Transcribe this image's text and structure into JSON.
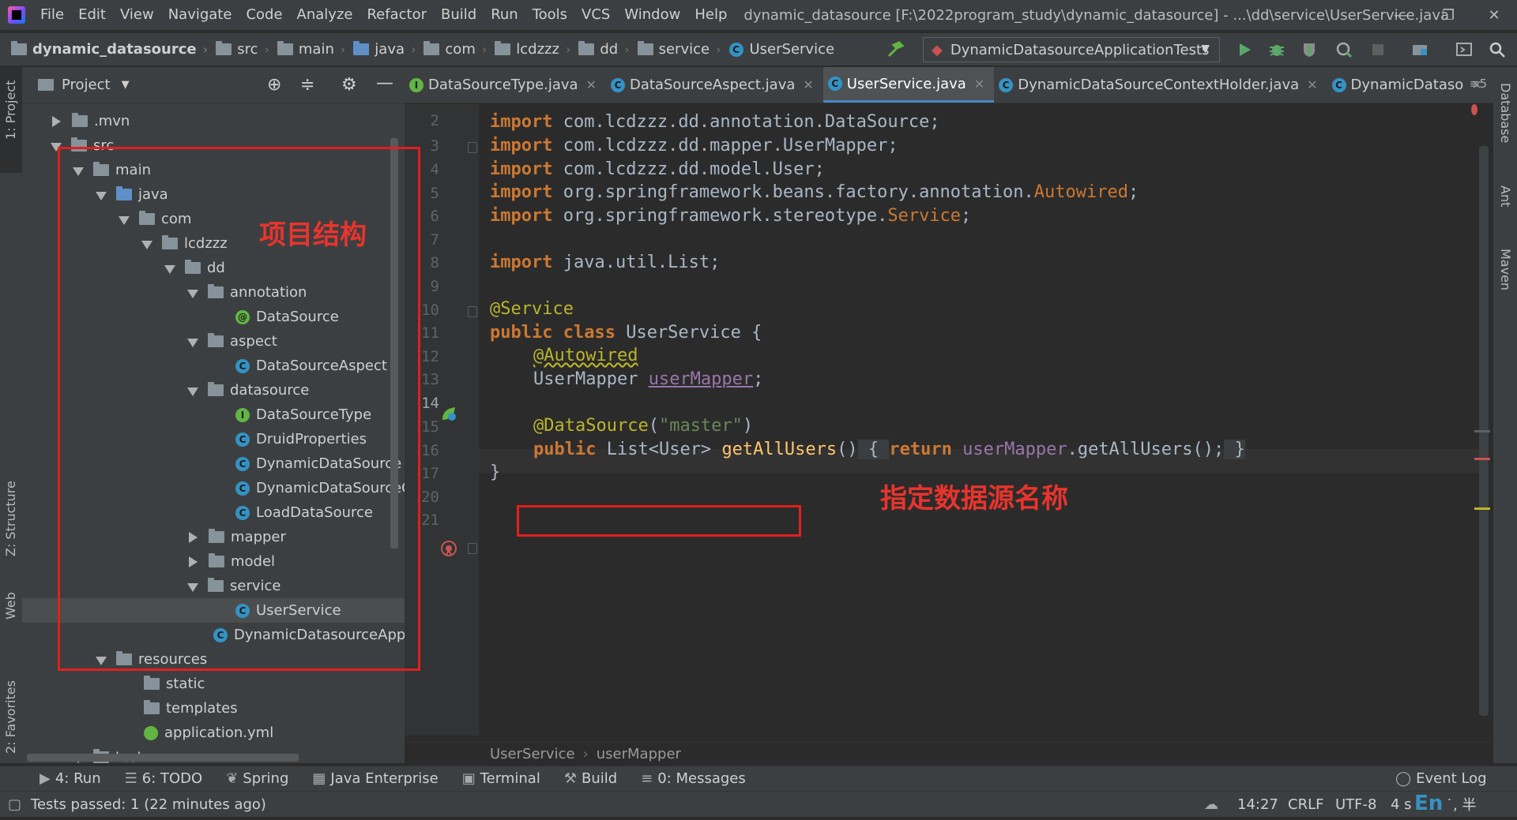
{
  "menu": {
    "items": [
      "File",
      "Edit",
      "View",
      "Navigate",
      "Code",
      "Analyze",
      "Refactor",
      "Build",
      "Run",
      "Tools",
      "VCS",
      "Window",
      "Help"
    ],
    "window_title": "dynamic_datasource [F:\\2022program_study\\dynamic_datasource] - ...\\dd\\service\\UserService.java",
    "minimize": "—",
    "restore": "❐",
    "close": "✕"
  },
  "navbar": {
    "crumbs": [
      "dynamic_datasource",
      "src",
      "main",
      "java",
      "com",
      "lcdzzz",
      "dd",
      "service",
      "UserService"
    ],
    "run_config": "DynamicDatasourceApplicationTests"
  },
  "left_strip": {
    "project": "1: Project",
    "structure": "Z: Structure",
    "web": "Web",
    "favorites": "2: Favorites"
  },
  "right_strip": {
    "database": "Database",
    "ant": "Ant",
    "maven": "Maven"
  },
  "project_panel": {
    "title": "Project",
    "tree": [
      {
        "label": ".mvn",
        "icon": "folder"
      },
      {
        "label": "src",
        "icon": "folder"
      },
      {
        "label": "main",
        "icon": "folder"
      },
      {
        "label": "java",
        "icon": "folder-blue"
      },
      {
        "label": "com",
        "icon": "folder"
      },
      {
        "label": "lcdzzz",
        "icon": "folder"
      },
      {
        "label": "dd",
        "icon": "folder"
      },
      {
        "label": "annotation",
        "icon": "folder"
      },
      {
        "label": "DataSource",
        "icon": "annotation"
      },
      {
        "label": "aspect",
        "icon": "folder"
      },
      {
        "label": "DataSourceAspect",
        "icon": "class"
      },
      {
        "label": "datasource",
        "icon": "folder"
      },
      {
        "label": "DataSourceType",
        "icon": "interface"
      },
      {
        "label": "DruidProperties",
        "icon": "class"
      },
      {
        "label": "DynamicDataSource",
        "icon": "class"
      },
      {
        "label": "DynamicDataSourceCo",
        "icon": "class"
      },
      {
        "label": "LoadDataSource",
        "icon": "class"
      },
      {
        "label": "mapper",
        "icon": "folder"
      },
      {
        "label": "model",
        "icon": "folder"
      },
      {
        "label": "service",
        "icon": "folder"
      },
      {
        "label": "UserService",
        "icon": "class"
      },
      {
        "label": "DynamicDatasourceApplic",
        "icon": "spring-class"
      },
      {
        "label": "resources",
        "icon": "folder"
      },
      {
        "label": "static",
        "icon": "folder"
      },
      {
        "label": "templates",
        "icon": "folder"
      },
      {
        "label": "application.yml",
        "icon": "yml"
      },
      {
        "label": "test",
        "icon": "folder"
      }
    ]
  },
  "editor": {
    "tabs": [
      {
        "label": "DataSourceType.java",
        "icon": "I"
      },
      {
        "label": "DataSourceAspect.java",
        "icon": "C"
      },
      {
        "label": "UserService.java",
        "icon": "C"
      },
      {
        "label": "DynamicDataSourceContextHolder.java",
        "icon": "C"
      },
      {
        "label": "DynamicDataso",
        "icon": "C"
      }
    ],
    "tab_close": "✕",
    "tab_overflow": "≡5",
    "line_numbers": [
      "2",
      "3",
      "4",
      "5",
      "6",
      "7",
      "8",
      "9",
      "10",
      "11",
      "12",
      "13",
      "14",
      "15",
      "16",
      "17",
      "20",
      "21"
    ],
    "code": {
      "l3_kw": "import",
      "l3_pkg": " com.lcdzzz.dd.annotation.",
      "l3_cls": "DataSource",
      "l3_end": ";",
      "l4_kw": "import",
      "l4_pkg": " com.lcdzzz.dd.mapper.UserMapper;",
      "l5_kw": "import",
      "l5_pkg": " com.lcdzzz.dd.model.User;",
      "l6_kw": "import",
      "l6_pkg": " org.springframework.beans.factory.annotation.",
      "l6_cls": "Autowired",
      "l6_end": ";",
      "l7_kw": "import",
      "l7_pkg": " org.springframework.stereotype.",
      "l7_cls": "Service",
      "l7_end": ";",
      "l9_kw": "import",
      "l9_pkg": " java.util.List;",
      "l11_ann": "@Service",
      "l12_kw": "public class",
      "l12_rest": " UserService {",
      "l13_ann": "@Autowired",
      "l14_type": "UserMapper ",
      "l14_fld": "userMapper",
      "l14_end": ";",
      "l16_ann": "@DataSource",
      "l16_open": "(",
      "l16_str": "\"master\"",
      "l16_close": ")",
      "l17_kw": "public",
      "l17_type": " List<User> ",
      "l17_fn": "getAllUsers",
      "l17_paren": "()",
      "l17_brace": " { ",
      "l17_ret": "return",
      "l17_fld": " userMapper",
      "l17_call": ".getAllUsers();",
      "l17_end": " }",
      "l20": "}"
    },
    "breadcrumb": [
      "UserService",
      "userMapper"
    ]
  },
  "annotations": {
    "project_structure": "项目结构",
    "datasource_name": "指定数据源名称"
  },
  "bottom_tools": [
    {
      "label": "4: Run",
      "icon": "▶"
    },
    {
      "label": "6: TODO",
      "icon": "☰"
    },
    {
      "label": "Spring",
      "icon": "❦"
    },
    {
      "label": "Java Enterprise",
      "icon": "▦"
    },
    {
      "label": "Terminal",
      "icon": "▣"
    },
    {
      "label": "Build",
      "icon": "⚒"
    },
    {
      "label": "0: Messages",
      "icon": "≡"
    }
  ],
  "event_log": "Event Log",
  "status": {
    "message": "Tests passed: 1 (22 minutes ago)",
    "position": "14:27",
    "line_sep": "CRLF",
    "encoding": "UTF-8",
    "indent": "4 s",
    "ime": "En",
    "ime_extra": "˙, 半"
  },
  "colors": {
    "keyword": "#cc7832",
    "annotation": "#bbb529",
    "string": "#6a8759",
    "field": "#9876aa",
    "method": "#ffc66d",
    "highlight_box": "#e0201d"
  }
}
